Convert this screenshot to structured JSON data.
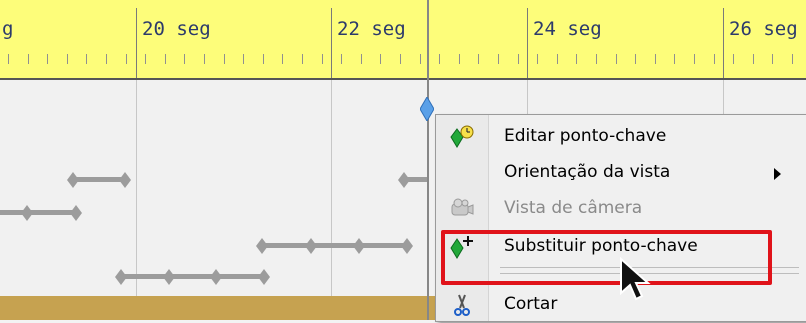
{
  "ruler": {
    "labels": [
      "g",
      "20 seg",
      "22 seg",
      "24 seg",
      "26 seg"
    ]
  },
  "context_menu": {
    "items": [
      {
        "label": "Editar ponto-chave",
        "icon": "keyframe-edit-icon",
        "enabled": true
      },
      {
        "label": "Orientação da vista",
        "icon": "",
        "enabled": true,
        "has_submenu": true
      },
      {
        "label": "Vista de câmera",
        "icon": "camera-icon",
        "enabled": false
      },
      {
        "label": "Substituir  ponto-chave",
        "icon": "keyframe-add-icon",
        "enabled": true,
        "highlighted": true
      },
      {
        "label": "Cortar",
        "icon": "scissors-icon",
        "enabled": true
      }
    ]
  },
  "colors": {
    "ruler_bg": "#fdfd7a",
    "ruler_text": "#2c3a6b",
    "track_bg": "#f1f1f1",
    "keyframe_gray": "#9c9c9c",
    "keyframe_blue": "#5aa0e8",
    "highlight_red": "#e0131a",
    "bottom_band": "#c6a250"
  }
}
